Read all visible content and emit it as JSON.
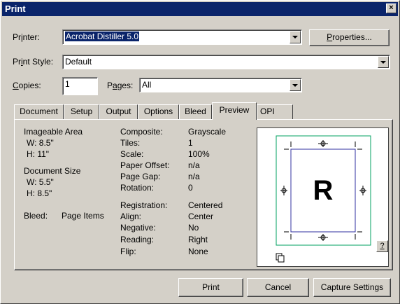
{
  "window": {
    "title": "Print",
    "close_glyph": "×"
  },
  "form": {
    "printer_label_pre": "Pr",
    "printer_label_ul": "i",
    "printer_label_post": "nter:",
    "printer_value": "Acrobat Distiller 5.0",
    "properties_pre": "",
    "properties_ul": "P",
    "properties_post": "roperties...",
    "style_label_pre": "Pr",
    "style_label_ul": "i",
    "style_label_post": "nt Style:",
    "style_value": "Default",
    "copies_label_pre": "",
    "copies_label_ul": "C",
    "copies_label_post": "opies:",
    "copies_value": "1",
    "pages_label_pre": "P",
    "pages_label_ul": "a",
    "pages_label_post": "ges:",
    "pages_value": "All"
  },
  "tabs": [
    "Document",
    "Setup",
    "Output",
    "Options",
    "Bleed",
    "Preview",
    "OPI"
  ],
  "active_tab": "Preview",
  "preview": {
    "imageable_heading": "Imageable Area",
    "imageable_w": "W: 8.5\"",
    "imageable_h": "H: 11\"",
    "document_heading": "Document Size",
    "document_w": "W: 5.5\"",
    "document_h": "H: 8.5\"",
    "bleed_label": "Bleed:",
    "bleed_value": "Page Items",
    "rows": [
      {
        "label": "Composite:",
        "value": "Grayscale"
      },
      {
        "label": "Tiles:",
        "value": "1"
      },
      {
        "label": "Scale:",
        "value": "100%"
      },
      {
        "label": "Paper Offset:",
        "value": "n/a"
      },
      {
        "label": "Page Gap:",
        "value": "n/a"
      },
      {
        "label": "Rotation:",
        "value": "0"
      },
      {
        "label": "Registration:",
        "value": "Centered"
      },
      {
        "label": "Align:",
        "value": "Center"
      },
      {
        "label": "Negative:",
        "value": "No"
      },
      {
        "label": "Reading:",
        "value": "Right"
      },
      {
        "label": "Flip:",
        "value": "None"
      }
    ],
    "page_letter": "R",
    "help_label": "?",
    "colors": {
      "paper_border": "#00a060",
      "page_border": "#3030a0"
    }
  },
  "buttons": {
    "print": "Print",
    "cancel": "Cancel",
    "capture": "Capture Settings"
  }
}
